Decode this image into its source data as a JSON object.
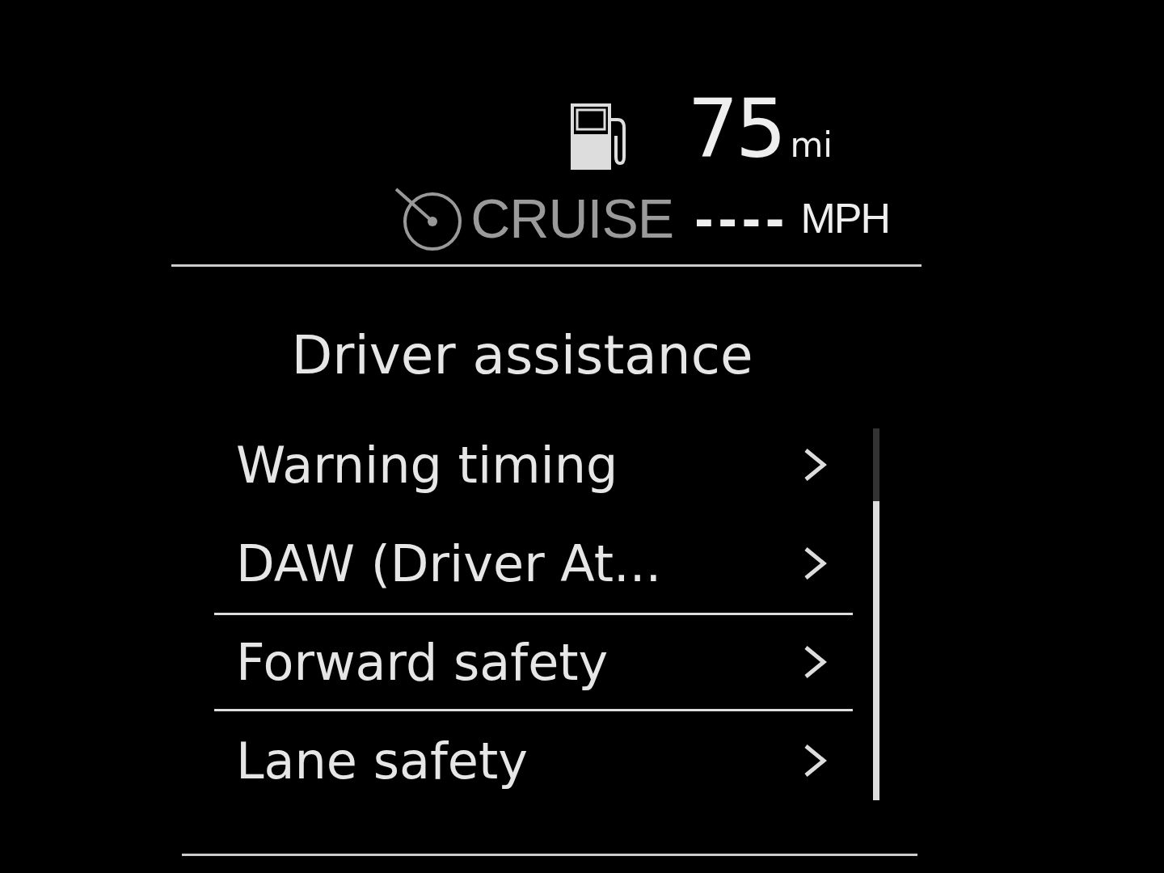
{
  "fuel": {
    "range": "75",
    "unit": "mi"
  },
  "cruise": {
    "label": "CRUISE",
    "speed": "----",
    "unit": "MPH"
  },
  "menu": {
    "title": "Driver assistance",
    "items": [
      {
        "label": "Warning timing",
        "selected": false
      },
      {
        "label": "DAW (Driver At...",
        "selected": false
      },
      {
        "label": "Forward safety",
        "selected": true
      },
      {
        "label": "Lane safety",
        "selected": false
      }
    ]
  }
}
